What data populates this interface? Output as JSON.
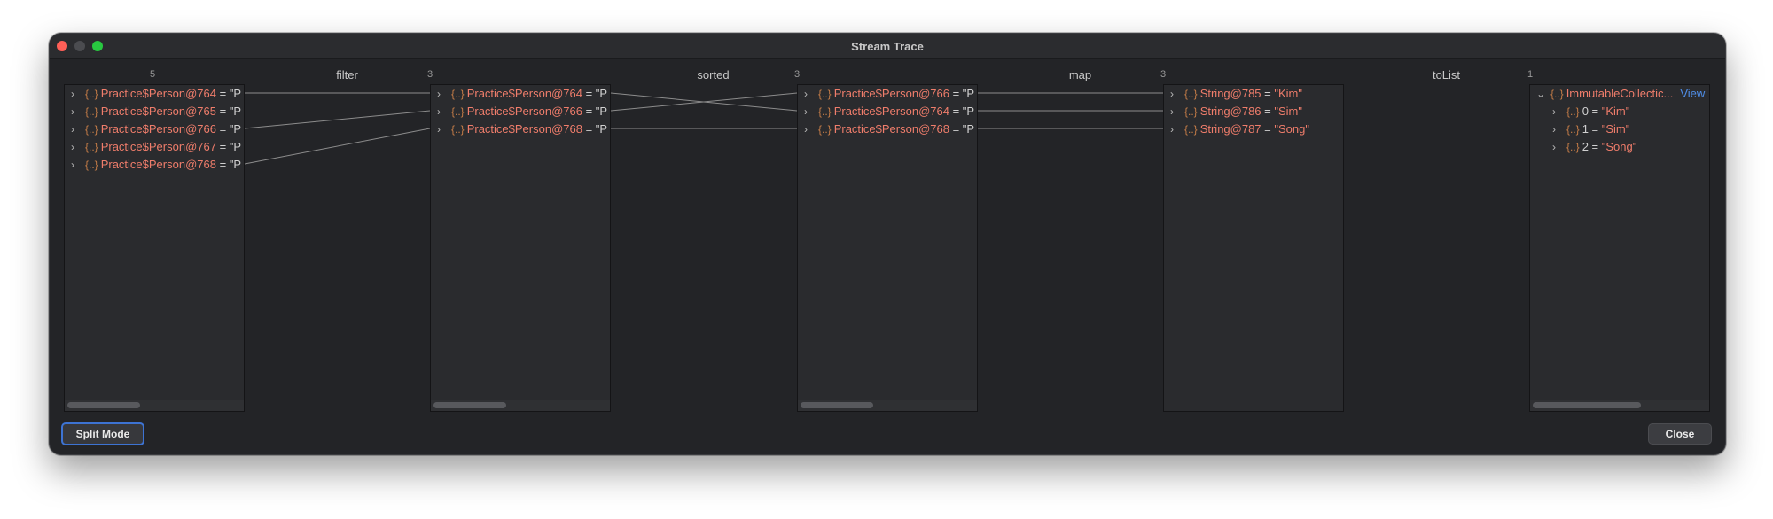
{
  "window": {
    "title": "Stream Trace"
  },
  "counts": [
    "5",
    "3",
    "3",
    "3",
    "1"
  ],
  "operations": [
    "filter",
    "sorted",
    "map",
    "toList"
  ],
  "columns": [
    {
      "rows": [
        {
          "label": "Practice$Person@764",
          "suffix": " = \"P"
        },
        {
          "label": "Practice$Person@765",
          "suffix": " = \"P"
        },
        {
          "label": "Practice$Person@766",
          "suffix": " = \"P"
        },
        {
          "label": "Practice$Person@767",
          "suffix": " = \"P"
        },
        {
          "label": "Practice$Person@768",
          "suffix": " = \"P"
        }
      ]
    },
    {
      "rows": [
        {
          "label": "Practice$Person@764",
          "suffix": " = \"P"
        },
        {
          "label": "Practice$Person@766",
          "suffix": " = \"P"
        },
        {
          "label": "Practice$Person@768",
          "suffix": " = \"P"
        }
      ]
    },
    {
      "rows": [
        {
          "label": "Practice$Person@766",
          "suffix": " = \"P"
        },
        {
          "label": "Practice$Person@764",
          "suffix": " = \"P"
        },
        {
          "label": "Practice$Person@768",
          "suffix": " = \"P"
        }
      ]
    },
    {
      "rows": [
        {
          "label": "String@785",
          "eq": " = ",
          "value": "\"Kim\""
        },
        {
          "label": "String@786",
          "eq": " = ",
          "value": "\"Sim\""
        },
        {
          "label": "String@787",
          "eq": " = ",
          "value": "\"Song\""
        }
      ]
    },
    {
      "root": {
        "label": "ImmutableCollectic...",
        "link": "View"
      },
      "children": [
        {
          "label": "0",
          "eq": " = ",
          "value": "\"Kim\""
        },
        {
          "label": "1",
          "eq": " = ",
          "value": "\"Sim\""
        },
        {
          "label": "2",
          "eq": " = ",
          "value": "\"Song\""
        }
      ]
    }
  ],
  "icons": {
    "expand": "chevron-right-icon",
    "collapse": "chevron-down-icon",
    "object": "object-braces-icon"
  },
  "buttons": {
    "split_mode": "Split Mode",
    "close": "Close"
  },
  "colors": {
    "accent": "#3d73d3",
    "value": "#ef7d6b",
    "link": "#4f8de6"
  }
}
